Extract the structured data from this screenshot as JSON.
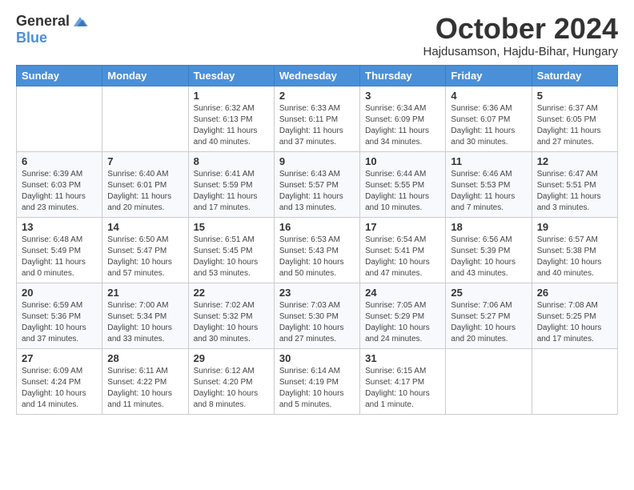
{
  "logo": {
    "line1": "General",
    "line2": "Blue"
  },
  "title": "October 2024",
  "location": "Hajdusamson, Hajdu-Bihar, Hungary",
  "days_of_week": [
    "Sunday",
    "Monday",
    "Tuesday",
    "Wednesday",
    "Thursday",
    "Friday",
    "Saturday"
  ],
  "weeks": [
    [
      {
        "day": "",
        "info": ""
      },
      {
        "day": "",
        "info": ""
      },
      {
        "day": "1",
        "info": "Sunrise: 6:32 AM\nSunset: 6:13 PM\nDaylight: 11 hours and 40 minutes."
      },
      {
        "day": "2",
        "info": "Sunrise: 6:33 AM\nSunset: 6:11 PM\nDaylight: 11 hours and 37 minutes."
      },
      {
        "day": "3",
        "info": "Sunrise: 6:34 AM\nSunset: 6:09 PM\nDaylight: 11 hours and 34 minutes."
      },
      {
        "day": "4",
        "info": "Sunrise: 6:36 AM\nSunset: 6:07 PM\nDaylight: 11 hours and 30 minutes."
      },
      {
        "day": "5",
        "info": "Sunrise: 6:37 AM\nSunset: 6:05 PM\nDaylight: 11 hours and 27 minutes."
      }
    ],
    [
      {
        "day": "6",
        "info": "Sunrise: 6:39 AM\nSunset: 6:03 PM\nDaylight: 11 hours and 23 minutes."
      },
      {
        "day": "7",
        "info": "Sunrise: 6:40 AM\nSunset: 6:01 PM\nDaylight: 11 hours and 20 minutes."
      },
      {
        "day": "8",
        "info": "Sunrise: 6:41 AM\nSunset: 5:59 PM\nDaylight: 11 hours and 17 minutes."
      },
      {
        "day": "9",
        "info": "Sunrise: 6:43 AM\nSunset: 5:57 PM\nDaylight: 11 hours and 13 minutes."
      },
      {
        "day": "10",
        "info": "Sunrise: 6:44 AM\nSunset: 5:55 PM\nDaylight: 11 hours and 10 minutes."
      },
      {
        "day": "11",
        "info": "Sunrise: 6:46 AM\nSunset: 5:53 PM\nDaylight: 11 hours and 7 minutes."
      },
      {
        "day": "12",
        "info": "Sunrise: 6:47 AM\nSunset: 5:51 PM\nDaylight: 11 hours and 3 minutes."
      }
    ],
    [
      {
        "day": "13",
        "info": "Sunrise: 6:48 AM\nSunset: 5:49 PM\nDaylight: 11 hours and 0 minutes."
      },
      {
        "day": "14",
        "info": "Sunrise: 6:50 AM\nSunset: 5:47 PM\nDaylight: 10 hours and 57 minutes."
      },
      {
        "day": "15",
        "info": "Sunrise: 6:51 AM\nSunset: 5:45 PM\nDaylight: 10 hours and 53 minutes."
      },
      {
        "day": "16",
        "info": "Sunrise: 6:53 AM\nSunset: 5:43 PM\nDaylight: 10 hours and 50 minutes."
      },
      {
        "day": "17",
        "info": "Sunrise: 6:54 AM\nSunset: 5:41 PM\nDaylight: 10 hours and 47 minutes."
      },
      {
        "day": "18",
        "info": "Sunrise: 6:56 AM\nSunset: 5:39 PM\nDaylight: 10 hours and 43 minutes."
      },
      {
        "day": "19",
        "info": "Sunrise: 6:57 AM\nSunset: 5:38 PM\nDaylight: 10 hours and 40 minutes."
      }
    ],
    [
      {
        "day": "20",
        "info": "Sunrise: 6:59 AM\nSunset: 5:36 PM\nDaylight: 10 hours and 37 minutes."
      },
      {
        "day": "21",
        "info": "Sunrise: 7:00 AM\nSunset: 5:34 PM\nDaylight: 10 hours and 33 minutes."
      },
      {
        "day": "22",
        "info": "Sunrise: 7:02 AM\nSunset: 5:32 PM\nDaylight: 10 hours and 30 minutes."
      },
      {
        "day": "23",
        "info": "Sunrise: 7:03 AM\nSunset: 5:30 PM\nDaylight: 10 hours and 27 minutes."
      },
      {
        "day": "24",
        "info": "Sunrise: 7:05 AM\nSunset: 5:29 PM\nDaylight: 10 hours and 24 minutes."
      },
      {
        "day": "25",
        "info": "Sunrise: 7:06 AM\nSunset: 5:27 PM\nDaylight: 10 hours and 20 minutes."
      },
      {
        "day": "26",
        "info": "Sunrise: 7:08 AM\nSunset: 5:25 PM\nDaylight: 10 hours and 17 minutes."
      }
    ],
    [
      {
        "day": "27",
        "info": "Sunrise: 6:09 AM\nSunset: 4:24 PM\nDaylight: 10 hours and 14 minutes."
      },
      {
        "day": "28",
        "info": "Sunrise: 6:11 AM\nSunset: 4:22 PM\nDaylight: 10 hours and 11 minutes."
      },
      {
        "day": "29",
        "info": "Sunrise: 6:12 AM\nSunset: 4:20 PM\nDaylight: 10 hours and 8 minutes."
      },
      {
        "day": "30",
        "info": "Sunrise: 6:14 AM\nSunset: 4:19 PM\nDaylight: 10 hours and 5 minutes."
      },
      {
        "day": "31",
        "info": "Sunrise: 6:15 AM\nSunset: 4:17 PM\nDaylight: 10 hours and 1 minute."
      },
      {
        "day": "",
        "info": ""
      },
      {
        "day": "",
        "info": ""
      }
    ]
  ]
}
